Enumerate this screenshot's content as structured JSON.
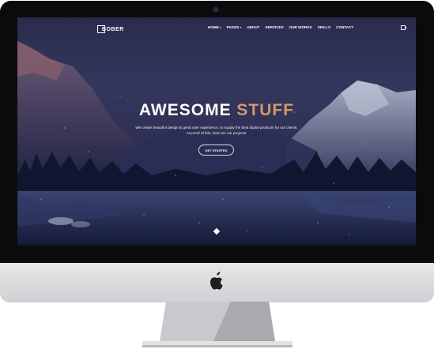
{
  "brand": {
    "name": "BOBER"
  },
  "nav": {
    "items": [
      {
        "label": "HOME",
        "has_dropdown": true
      },
      {
        "label": "PAGES",
        "has_dropdown": true
      },
      {
        "label": "ABOUT",
        "has_dropdown": false
      },
      {
        "label": "SERVICES",
        "has_dropdown": false
      },
      {
        "label": "OUR WORKS",
        "has_dropdown": false
      },
      {
        "label": "SKILLS",
        "has_dropdown": false
      },
      {
        "label": "CONTACT",
        "has_dropdown": false
      }
    ],
    "menu_toggle_icon": "panel-toggle-icon"
  },
  "hero": {
    "title_main": "AWESOME ",
    "title_accent": "STUFF",
    "text_line1": "We create beautiful design & great user experience, to supply the best digital products for our clients.",
    "text_line2": "As proof of this, here are our projects.",
    "cta_label": "GET STARTED",
    "scroll_icon": "scroll-down-diamond-icon"
  },
  "device": {
    "logo_icon": "apple-logo-icon"
  },
  "colors": {
    "accent": "#d19a6a",
    "sky_top": "#2a2c4e",
    "water": "#1b2140",
    "bezel": "#0b0b0d",
    "chin": "#d9dadd"
  }
}
